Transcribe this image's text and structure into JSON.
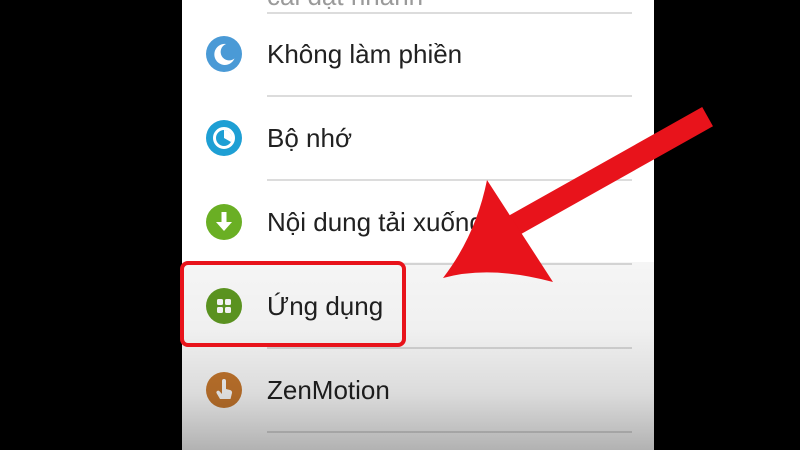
{
  "settings_list": {
    "partial_top_label": "cài đặt nhanh",
    "items": [
      {
        "label": "Không làm phiền",
        "icon": "moon-icon",
        "color": "#4a9ad6"
      },
      {
        "label": "Bộ nhớ",
        "icon": "storage-pie-icon",
        "color": "#1e9fd4"
      },
      {
        "label": "Nội dung tải xuống",
        "icon": "download-icon",
        "color": "#6aaf24"
      },
      {
        "label": "Ứng dụng",
        "icon": "apps-grid-icon",
        "color": "#5f9a22"
      },
      {
        "label": "ZenMotion",
        "icon": "touch-gesture-icon",
        "color": "#c9792e"
      }
    ]
  },
  "annotations": {
    "highlight_color": "#e8131b",
    "arrow": "pointing-arrow"
  }
}
